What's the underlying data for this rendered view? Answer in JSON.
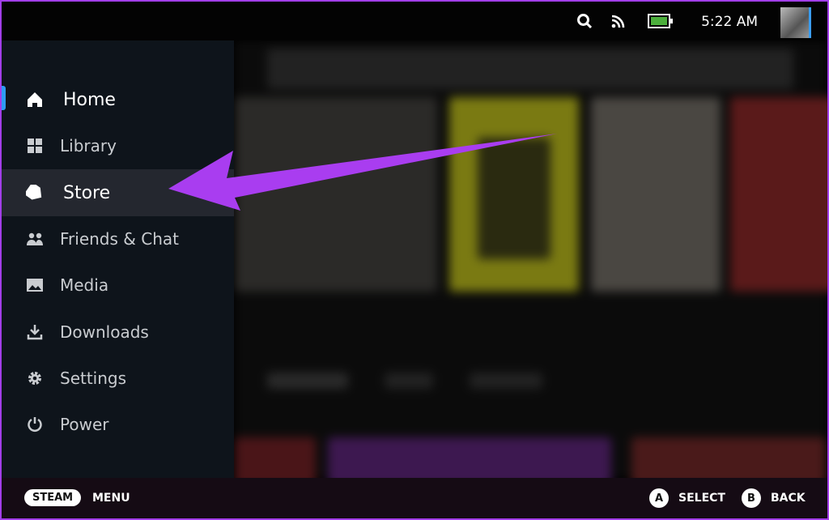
{
  "status_bar": {
    "time": "5:22 AM",
    "icons": [
      "search-icon",
      "wifi-icon",
      "battery-icon"
    ],
    "battery_color": "#4caf3c"
  },
  "sidebar": {
    "items": [
      {
        "label": "Home",
        "icon": "home-icon"
      },
      {
        "label": "Library",
        "icon": "grid-icon"
      },
      {
        "label": "Store",
        "icon": "tag-icon"
      },
      {
        "label": "Friends & Chat",
        "icon": "friends-icon"
      },
      {
        "label": "Media",
        "icon": "image-icon"
      },
      {
        "label": "Downloads",
        "icon": "download-icon"
      },
      {
        "label": "Settings",
        "icon": "gear-icon"
      },
      {
        "label": "Power",
        "icon": "power-icon"
      }
    ]
  },
  "footer": {
    "steam": "STEAM",
    "menu": "MENU",
    "a": "A",
    "select": "SELECT",
    "b": "B",
    "back": "BACK"
  },
  "annotation": {
    "arrow_color": "#a93df0"
  }
}
